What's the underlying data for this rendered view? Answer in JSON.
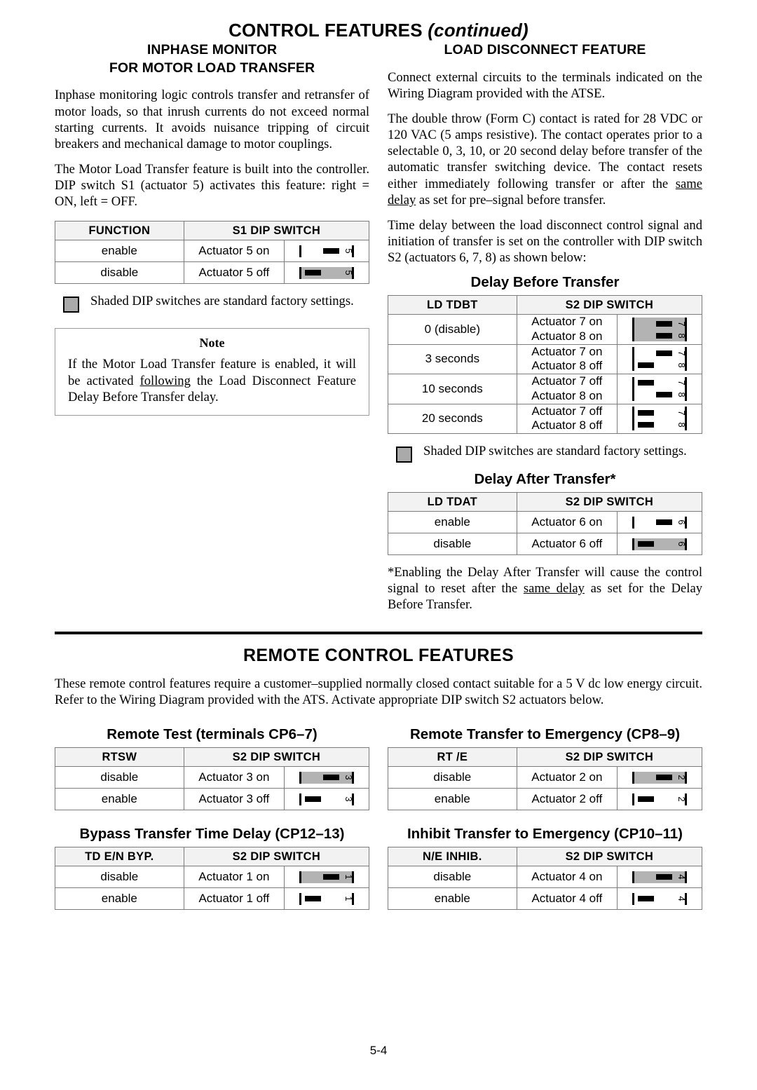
{
  "page": {
    "title": "CONTROL FEATURES",
    "title_suffix": "(continued)",
    "footer": "5-4"
  },
  "left_column": {
    "heading_line1": "INPHASE MONITOR",
    "heading_line2": "FOR MOTOR LOAD TRANSFER",
    "paragraph1": "Inphase monitoring logic controls transfer and retransfer of motor loads, so that inrush currents do not exceed normal starting currents. It avoids nuisance tripping of circuit breakers and mechanical damage to motor couplings.",
    "paragraph2": "The Motor Load Transfer feature is built into the controller.  DIP switch S1 (actuator 5) activates this feature:  right = ON, left = OFF.",
    "table": {
      "headers": [
        "FUNCTION",
        "S1 DIP SWITCH"
      ],
      "rows": [
        {
          "function": "enable",
          "actuator": "Actuator 5 on",
          "shaded": false,
          "switches": [
            {
              "num": "5",
              "state": "on"
            }
          ]
        },
        {
          "function": "disable",
          "actuator": "Actuator 5 off",
          "shaded": true,
          "switches": [
            {
              "num": "5",
              "state": "off"
            }
          ]
        }
      ]
    },
    "legend": "Shaded DIP switches are standard factory settings.",
    "note": {
      "title": "Note",
      "text_before": "If the Motor Load Transfer feature is enabled, it will be activated ",
      "text_underline": "following",
      "text_after": " the Load Disconnect Feature Delay Before Transfer delay."
    }
  },
  "right_column": {
    "heading": "LOAD DISCONNECT FEATURE",
    "paragraph1": "Connect external circuits to the terminals indicated on the Wiring Diagram provided with the ATSE.",
    "paragraph2_before": "The double throw (Form C) contact is rated for 28 VDC or 120 VAC (5 amps resistive).  The contact operates prior to a selectable 0, 3, 10, or 20 second delay before transfer of the automatic transfer switching device.  The contact resets either immediately following transfer or after the ",
    "paragraph2_underline": "same delay",
    "paragraph2_after": " as set for pre–signal before transfer.",
    "paragraph3": "Time delay between the load disconnect control signal and initiation of transfer is set on the controller with DIP switch S2 (actuators 6, 7, 8) as shown below:",
    "delay_before": {
      "title": "Delay Before Transfer",
      "headers": [
        "LD TDBT",
        "S2 DIP SWITCH"
      ],
      "rows": [
        {
          "function": "0 (disable)",
          "actuator": "Actuator 7 on\nActuator 8 on",
          "shaded": true,
          "switches": [
            {
              "num": "7",
              "state": "on"
            },
            {
              "num": "8",
              "state": "on"
            }
          ]
        },
        {
          "function": "3 seconds",
          "actuator": "Actuator 7 on\nActuator 8 off",
          "shaded": false,
          "switches": [
            {
              "num": "7",
              "state": "on"
            },
            {
              "num": "8",
              "state": "off"
            }
          ]
        },
        {
          "function": "10 seconds",
          "actuator": "Actuator 7 off\nActuator 8 on",
          "shaded": false,
          "switches": [
            {
              "num": "7",
              "state": "off"
            },
            {
              "num": "8",
              "state": "on"
            }
          ]
        },
        {
          "function": "20 seconds",
          "actuator": "Actuator 7 off\nActuator 8 off",
          "shaded": false,
          "switches": [
            {
              "num": "7",
              "state": "off"
            },
            {
              "num": "8",
              "state": "off"
            }
          ]
        }
      ]
    },
    "legend": "Shaded DIP switches are standard factory settings.",
    "delay_after": {
      "title": "Delay After Transfer*",
      "headers": [
        "LD TDAT",
        "S2 DIP SWITCH"
      ],
      "rows": [
        {
          "function": "enable",
          "actuator": "Actuator 6 on",
          "shaded": false,
          "switches": [
            {
              "num": "6",
              "state": "on"
            }
          ]
        },
        {
          "function": "disable",
          "actuator": "Actuator 6 off",
          "shaded": true,
          "switches": [
            {
              "num": "6",
              "state": "off"
            }
          ]
        }
      ]
    },
    "footnote_before": "*Enabling the Delay After Transfer will cause the control signal to reset after the ",
    "footnote_underline": "same delay",
    "footnote_after": " as set for the Delay Before Transfer."
  },
  "remote": {
    "section_title": "REMOTE CONTROL FEATURES",
    "intro": "These remote control features require a customer–supplied normally closed contact suitable for a 5 V dc low energy circuit.  Refer to the Wiring Diagram provided with the ATS.  Activate appropriate DIP switch S2 actuators below.",
    "tables": [
      {
        "title": "Remote Test (terminals CP6–7)",
        "headers": [
          "RTSW",
          "S2 DIP SWITCH"
        ],
        "rows": [
          {
            "function": "disable",
            "actuator": "Actuator 3 on",
            "shaded": true,
            "switches": [
              {
                "num": "3",
                "state": "on"
              }
            ]
          },
          {
            "function": "enable",
            "actuator": "Actuator 3 off",
            "shaded": false,
            "switches": [
              {
                "num": "3",
                "state": "off"
              }
            ]
          }
        ]
      },
      {
        "title": "Remote Transfer to Emergency (CP8–9)",
        "headers": [
          "RT /E",
          "S2 DIP SWITCH"
        ],
        "rows": [
          {
            "function": "disable",
            "actuator": "Actuator 2 on",
            "shaded": true,
            "switches": [
              {
                "num": "2",
                "state": "on"
              }
            ]
          },
          {
            "function": "enable",
            "actuator": "Actuator 2 off",
            "shaded": false,
            "switches": [
              {
                "num": "2",
                "state": "off"
              }
            ]
          }
        ]
      },
      {
        "title": "Bypass Transfer Time Delay (CP12–13)",
        "headers": [
          "TD E/N BYP.",
          "S2 DIP SWITCH"
        ],
        "rows": [
          {
            "function": "disable",
            "actuator": "Actuator 1 on",
            "shaded": true,
            "switches": [
              {
                "num": "1",
                "state": "on"
              }
            ]
          },
          {
            "function": "enable",
            "actuator": "Actuator 1 off",
            "shaded": false,
            "switches": [
              {
                "num": "1",
                "state": "off"
              }
            ]
          }
        ]
      },
      {
        "title": "Inhibit Transfer to Emergency (CP10–11)",
        "headers": [
          "N/E INHIB.",
          "S2 DIP SWITCH"
        ],
        "rows": [
          {
            "function": "disable",
            "actuator": "Actuator 4 on",
            "shaded": true,
            "switches": [
              {
                "num": "4",
                "state": "on"
              }
            ]
          },
          {
            "function": "enable",
            "actuator": "Actuator 4 off",
            "shaded": false,
            "switches": [
              {
                "num": "4",
                "state": "off"
              }
            ]
          }
        ]
      }
    ]
  },
  "colors": {
    "shade_gray": "#b3b3b3",
    "header_gray": "#f2f2f2",
    "border_gray": "#7b7b7b",
    "legend_box": "#aaaaaa"
  }
}
